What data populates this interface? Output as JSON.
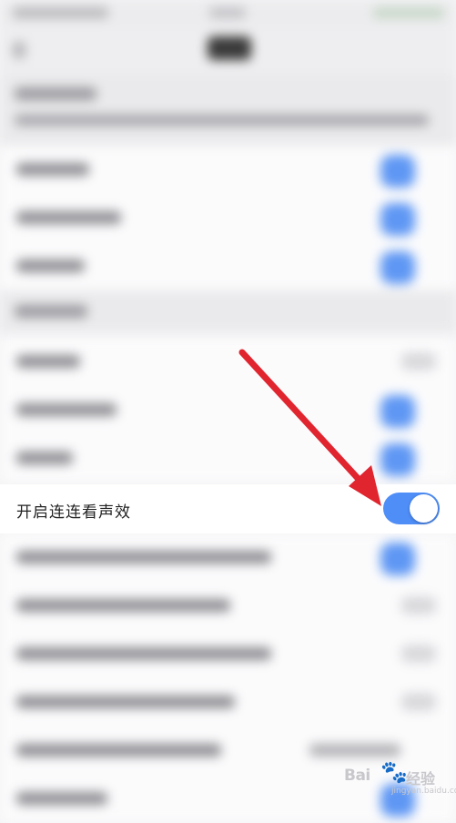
{
  "highlighted_setting": {
    "label": "开启连连看声效",
    "toggle_state": "on",
    "toggle_color": "#4f8ef7"
  },
  "annotation": {
    "type": "arrow",
    "color": "#e0252f"
  },
  "watermark": {
    "logo": "Bai",
    "paw_icon": "paw-icon",
    "text": "经验",
    "sub": "jingyan.baidu.com"
  },
  "colors": {
    "toggle_on": "#4f8ef7",
    "arrow": "#e0252f",
    "background": "#f4f4f6"
  }
}
